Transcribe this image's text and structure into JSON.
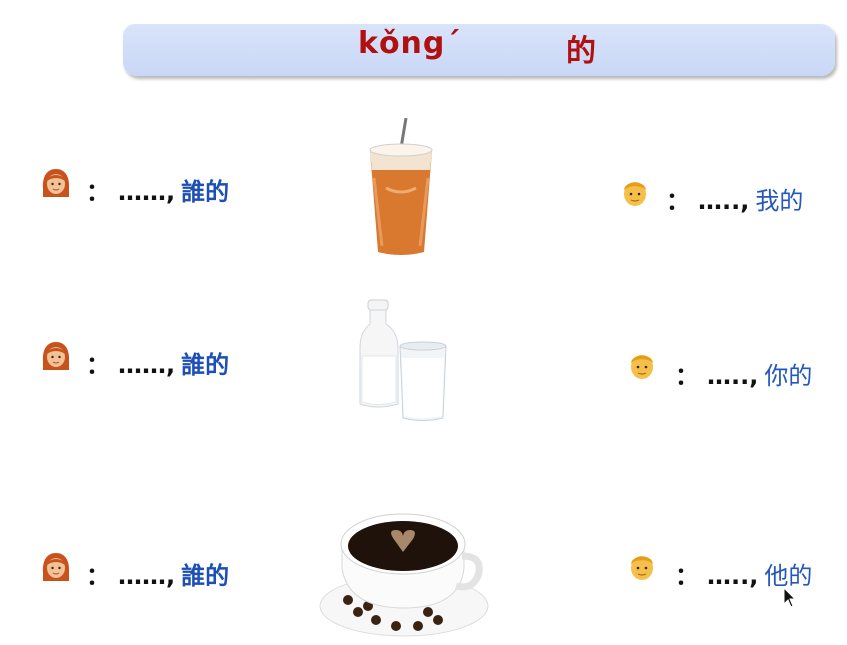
{
  "title": {
    "pinyin": "kǒng´",
    "hanzi": "的"
  },
  "rows": [
    {
      "question": {
        "colon": "：",
        "dots": "……,",
        "text": "誰的"
      },
      "answer": {
        "colon": "：",
        "dots": "…..,",
        "text": "我的"
      },
      "image": "iced-milk-tea"
    },
    {
      "question": {
        "colon": "：",
        "dots": "……,",
        "text": "誰的"
      },
      "answer": {
        "colon": "：",
        "dots": "…..,",
        "text": "你的"
      },
      "image": "milk-bottle-and-glass"
    },
    {
      "question": {
        "colon": "：",
        "dots": "……,",
        "text": "誰的"
      },
      "answer": {
        "colon": "：",
        "dots": "…..,",
        "text": "他的"
      },
      "image": "coffee-cup"
    }
  ],
  "colors": {
    "title": "#b01010",
    "question": "#1d4fb5",
    "answer": "#2457bd",
    "bar": "#ccd9f7"
  }
}
